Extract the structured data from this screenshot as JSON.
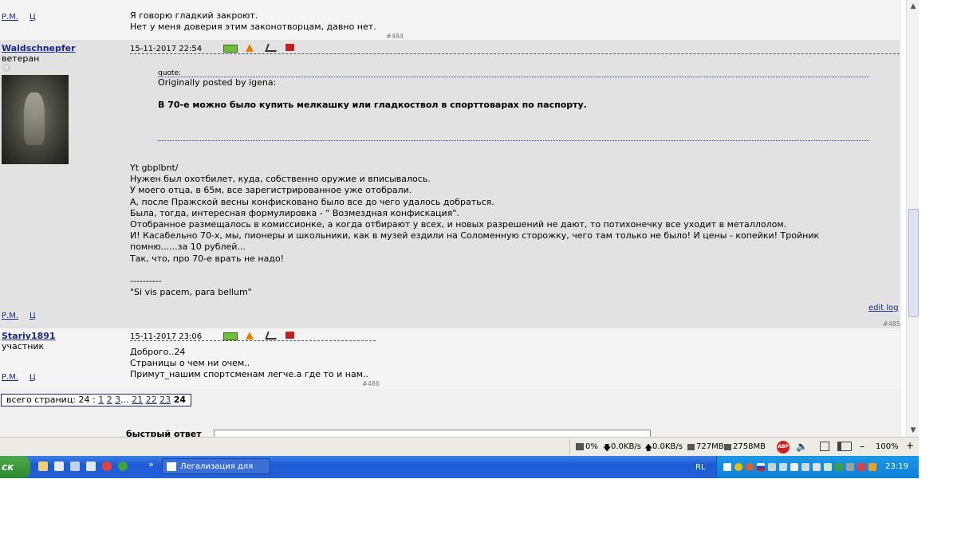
{
  "posts": [
    {
      "links": [
        "Р.М.",
        "Ц"
      ],
      "lines": [
        "Я говорю гладкий закроют.",
        "Нет у меня доверия этим законотворцам, давно нет."
      ],
      "num": "#484"
    },
    {
      "author": "Waldschnepfer",
      "rank": "ветеран",
      "date": "15-11-2017 22:54",
      "quote_label": "quote:",
      "quote_by": "Originally posted by igena:",
      "quote_text": "В 70-е можно было купить мелкашку или гладкоствол в спорттоварах по паспорту.",
      "lines": [
        "Yt gbplbnt/",
        "Нужен был охотбилет, куда, собственно оружие и вписывалось.",
        "У моего отца, в 65м, все зарегистрированное уже отобрали.",
        "А, после Пражской весны конфисковано было все до чего удалось добраться.",
        "Была, тогда, интересная формулировка - \" Возмездная конфискация\".",
        "Отобранное размещалось в комиссионке, а когда отбирают у всех, и новых разрешений не дают, то потихонечку все уходит в металлолом.",
        "И! Касабельно 70-х, мы, пионеры и школьники, как в музей ездили на Соломенную сторожку, чего там только не было! И цены - копейки! Тройник",
        "помню......за 10 рублей...",
        "Так, что, про 70-е врать не надо!",
        "",
        "----------",
        "\"Si vis pacem, para bellum\""
      ],
      "edit_log": "edit log",
      "links": [
        "Р.М.",
        "Ц"
      ],
      "num": "#485"
    },
    {
      "author": "Stariy1891",
      "rank": "участник",
      "date": "15-11-2017 23:06",
      "lines": [
        "Доброго..24",
        "Страницы о чем ни очем..",
        "Примут_нашим спортсменам легче.а где то и нам.."
      ],
      "links": [
        "Р.М.",
        "Ц"
      ],
      "num": "#486"
    }
  ],
  "pager": {
    "label": "всего страниц: 24 :",
    "pages": [
      "1",
      "2",
      "3"
    ],
    "ellipsis": "...",
    "pages2": [
      "21",
      "22",
      "23"
    ],
    "current": "24"
  },
  "quick_reply": "быстрый ответ",
  "statusbar": {
    "cpu": "0%",
    "down": "0.0KB/s",
    "up": "0.0KB/s",
    "mem1": "727MB",
    "mem2": "2758MB",
    "abp": "ABP",
    "zoom": "100%",
    "minus": "–",
    "plus": "+"
  },
  "taskbar": {
    "start": "ск",
    "more": "»",
    "task_title": "Легализация для на...",
    "lang": "RL",
    "clock": "23:19"
  },
  "colors": {
    "link": "#1a2a80",
    "taskbar": "#2460d8",
    "tray": "#0e7fd8"
  }
}
